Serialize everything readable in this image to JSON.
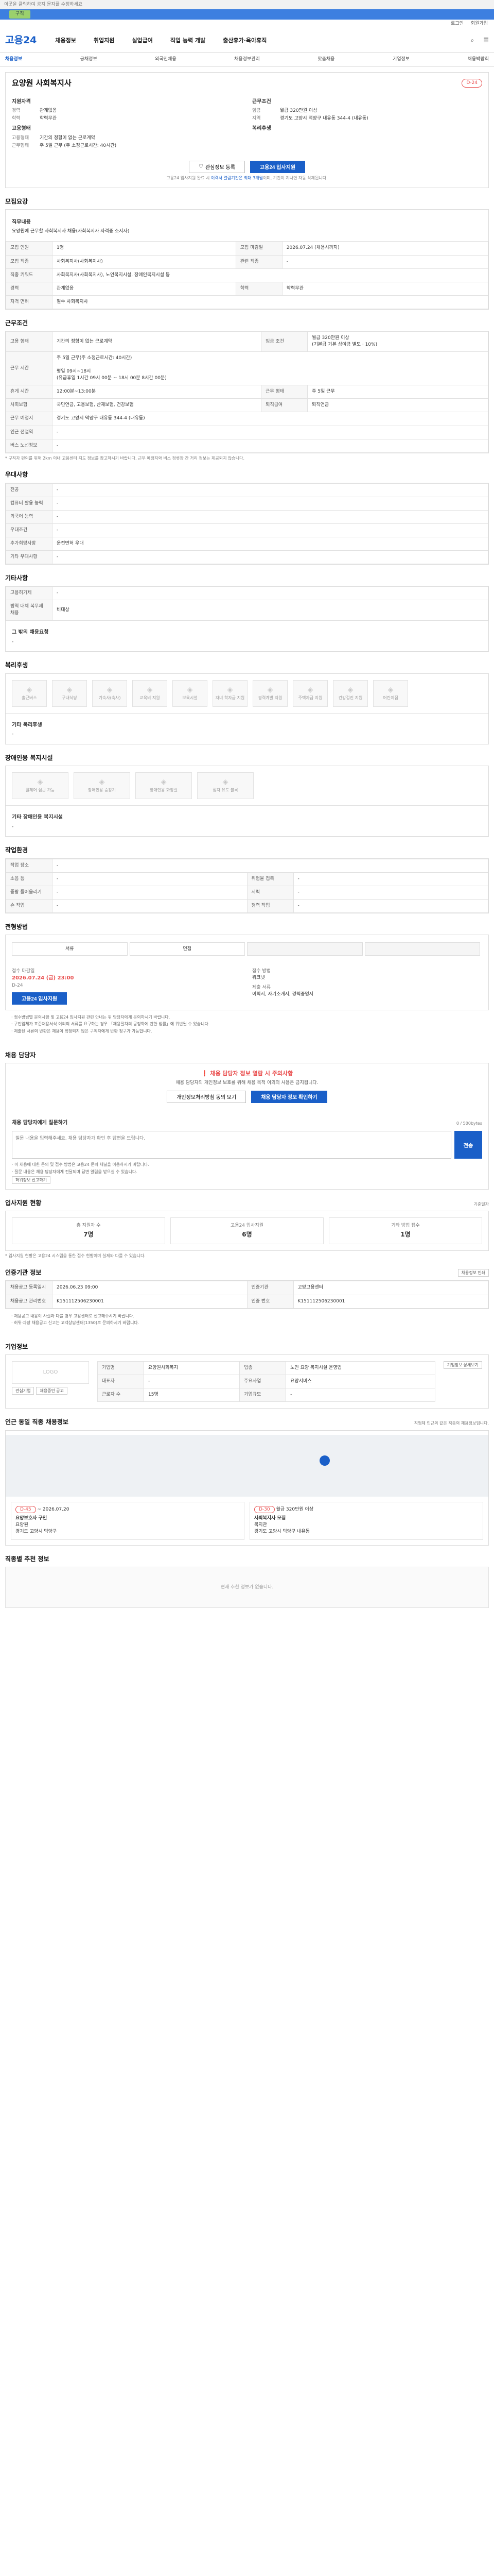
{
  "topnote": "이곳을 클릭하여 공지 문자를 수정하세요",
  "topbar_pill": "구직",
  "util": [
    "로그인",
    "회원가입"
  ],
  "logo": "고용24",
  "gnb": [
    "채용정보",
    "취업지원",
    "실업급여",
    "직업 능력 개발",
    "출산휴가·육아휴직"
  ],
  "subnav": [
    "채용정보",
    "공채정보",
    "외국인채용",
    "채용정보관리",
    "맞춤채용",
    "기업정보",
    "채용박람회"
  ],
  "job": {
    "company": "",
    "title": "요양원 사회복지사",
    "dday": "D-24",
    "qual_head": "지원자격",
    "cond_head": "근무조건",
    "qual": [
      {
        "k": "경력",
        "v": "관계없음"
      },
      {
        "k": "학력",
        "v": "학력무관"
      }
    ],
    "cond": [
      {
        "k": "임금",
        "v": "월급 320만원 이상"
      },
      {
        "k": "지역",
        "v": "경기도 고양시 덕양구 내유동 344-4 (내유동)"
      }
    ],
    "emp_head": "고용형태",
    "emp": [
      {
        "k": "고용형태",
        "v": "기간의 정함이 없는 근로계약"
      },
      {
        "k": "근무형태",
        "v": "주 5일 근무 (주 소정근로시간: 40시간)"
      }
    ],
    "welfare_head": "복리후생",
    "btn_scrap": "관심정보 등록",
    "btn_apply": "고용24 입사지원",
    "notice_pre": "고용24 입사지원 완료 시 ",
    "notice_hl": "이력서 열람기간은 최대 3개월",
    "notice_post": "이며, 기간이 지나면 자동 삭제됩니다."
  },
  "recruit": {
    "title": "모집요강",
    "duty_head": "직무내용",
    "duty_text": "요양원에 근무할 사회복지사 채용(사회복지사 자격증 소지자)",
    "rows": [
      {
        "k": "모집 인원",
        "v": "1명",
        "k2": "모집 마감일",
        "v2": "2026.07.24 (채용시까지)"
      },
      {
        "k": "모집 직종",
        "v": "사회복지사(사회복지사)",
        "k2": "관련 직종",
        "v2": "-"
      },
      {
        "k": "직종 키워드",
        "v": "사회복지사(사회복지사), 노인복지시설, 장애인복지시설 등",
        "k2": "",
        "v2": ""
      },
      {
        "k": "경력",
        "v": "관계없음",
        "k2": "학력",
        "v2": "학력무관"
      },
      {
        "k": "자격 면허",
        "v": "필수 사회복지사",
        "k2": "",
        "v2": ""
      }
    ]
  },
  "workcond": {
    "title": "근무조건",
    "rows": [
      {
        "k": "고용 형태",
        "v": "기간의 정함이 없는 근로계약",
        "k2": "임금 조건",
        "v2": "월급 320만원 이상\n(기본급 기본 상여금 별도 · 10%)"
      },
      {
        "k": "근무 시간",
        "v": "주 5일 근무(주 소정근로시간: 40시간)\n\n평일 09시~18시\n(유급휴일 1시간 09시 00분 ~ 18시 00분 8시간 00분)",
        "k2": "",
        "v2": ""
      },
      {
        "k": "휴게 시간",
        "v": "12:00분~13:00분",
        "k2": "근무 형태",
        "v2": "주 5일 근무"
      },
      {
        "k": "사회보험",
        "v": "국민연금, 고용보험, 산재보험, 건강보험",
        "k2": "퇴직급여",
        "v2": "퇴직연금"
      },
      {
        "k": "근무 예정지",
        "v": "경기도 고양시 덕양구 내유동 344-4 (내유동)",
        "k2": "",
        "v2": ""
      },
      {
        "k": "인근 전철역",
        "v": "-",
        "k2": "",
        "v2": ""
      },
      {
        "k": "버스 노선정보",
        "v": "-",
        "k2": "",
        "v2": ""
      }
    ],
    "note": "* 구직자 편의를 위해 2km 이내 고용센터 지도 정보를 참고하시기 바랍니다. 근무 예정지와 버스 정류장 간 거리 정보는 제공되지 않습니다."
  },
  "prefer": {
    "title": "우대사항",
    "rows": [
      {
        "k": "전공",
        "v": "-"
      },
      {
        "k": "컴퓨터 활용 능력",
        "v": "-"
      },
      {
        "k": "외국어 능력",
        "v": "-"
      },
      {
        "k": "우대조건",
        "v": "-"
      },
      {
        "k": "추가희망사항",
        "v": "운전면허 우대"
      },
      {
        "k": "기타 우대사항",
        "v": "-"
      }
    ]
  },
  "etc": {
    "title": "기타사항",
    "rows": [
      {
        "k": "고용허가제",
        "v": "-"
      },
      {
        "k": "병역 대체 복무제 채용",
        "v": "비대상"
      }
    ],
    "extra_head": "그 밖의 채용요청",
    "extra_val": "-"
  },
  "welfare": {
    "title": "복리후생",
    "items": [
      "출근버스",
      "구내식당",
      "기숙사(숙사)",
      "교육비 지원",
      "보육시설",
      "자녀 학자금 지원",
      "경력계발 지원",
      "주택자금 지원",
      "건강검진 지원",
      "어린이집"
    ],
    "other_head": "기타 복리후생",
    "other_val": "-"
  },
  "disabled": {
    "title": "장애인용 복지시설",
    "items": [
      "휠체어 접근 가능",
      "장애인용 승강기",
      "장애인용 화장실",
      "점자 유도 블록"
    ],
    "other_head": "기타 장애인용 복지시설",
    "other_val": "-"
  },
  "env": {
    "title": "작업환경",
    "rows": [
      {
        "k": "작업 장소",
        "v": "-",
        "k2": "",
        "v2": ""
      },
      {
        "k": "소음 등",
        "v": "-",
        "k2": "위험물 접촉",
        "v2": "-"
      },
      {
        "k": "중량 들어올리기",
        "v": "-",
        "k2": "시력",
        "v2": "-"
      },
      {
        "k": "손 작업",
        "v": "-",
        "k2": "청력 작업",
        "v2": "-"
      }
    ]
  },
  "process": {
    "title": "전형방법",
    "steps": [
      "서류",
      "면접",
      "",
      ""
    ],
    "apply_lbl": "접수 마감일",
    "apply_date": "2026.07.24 (금) 23:00",
    "apply_note": "D-24",
    "apply_btn": "고용24 입사지원",
    "method_lbl": "접수 방법",
    "method_val": "워크넷",
    "doc_lbl": "제출 서류",
    "doc_val": "이력서, 자기소개서, 경력증명서",
    "bullets": [
      "· 접수방법별 문의사항 및 고용24 입사지원 관련 안내는 위 담당자에게 문의하시기 바랍니다.",
      "· 구인업체가 표준채용서식 이외의 서류를 요구하는 경우 「채용절차의 공정화에 관한 법률」에 위반될 수 있습니다.",
      "· 제출된 서류의 반환은 채용이 확정되지 않은 구직자에게 반환 청구가 가능합니다."
    ]
  },
  "contact": {
    "title": "채용 담당자",
    "alert_head": "채용 담당자 정보 열람 시 주의사항",
    "alert_body": "채용 담당자의 개인정보 보호를 위해 채용 목적 이외의 사용은 금지됩니다.",
    "btn_view": "채용 담당자 정보 확인하기",
    "btn_privacy": "개인정보처리방침 동의 보기",
    "qna_head": "채용 담당자에게 질문하기",
    "qna_placeholder": "질문 내용을 입력해주세요. 채용 담당자가 확인 후 답변을 드립니다.",
    "qna_send": "전송",
    "qna_count": "0 / 500bytes",
    "tips": [
      "· 이 채용에 대한 문의 및 접수 방법은 고용24 문의 채널을 이용하시기 바랍니다.",
      "· 질문 내용은 채용 담당자에게 전달되며 답변 알림을 받으실 수 있습니다."
    ],
    "report_btn": "허위정보 신고하기"
  },
  "status": {
    "title": "입사지원 현황",
    "unit": "기준일자",
    "items": [
      {
        "label": "총 지원자 수",
        "value": "7명"
      },
      {
        "label": "고용24 입사지원",
        "value": "6명"
      },
      {
        "label": "기타 방법 접수",
        "value": "1명"
      }
    ],
    "note": "* 입사지원 현황은 고용24 시스템을 통한 접수 현황이며 실제와 다를 수 있습니다."
  },
  "meta": {
    "title": "인증기관 정보",
    "print_btn": "채용정보 인쇄",
    "rows": [
      {
        "k": "채용공고 등록일시",
        "v": "2026.06.23 09:00",
        "k2": "인증기관",
        "v2": "고양고용센터"
      },
      {
        "k": "채용공고 관리번호",
        "v": "K151112506230001",
        "k2": "인증 번호",
        "v2": "K151112506230001"
      }
    ],
    "bullets": [
      "· 채용공고 내용이 사실과 다를 경우 고용센터로 신고해주시기 바랍니다.",
      "· 허위·과장 채용공고 신고는 고객상담센터(1350)로 문의하시기 바랍니다."
    ]
  },
  "company": {
    "title": "기업정보",
    "logo_text": "LOGO",
    "btn_detail": "기업정보 상세보기",
    "btn_scrap": "관심기업",
    "btn_other": "채용중인 공고",
    "rows": [
      {
        "k": "기업명",
        "v": "요양원사회복지",
        "k2": "업종",
        "v2": "노인 요양 복지시설 운영업"
      },
      {
        "k": "대표자",
        "v": "-",
        "k2": "주요사업",
        "v2": "요양서비스"
      },
      {
        "k": "근로자 수",
        "v": "15명",
        "k2": "기업규모",
        "v2": "-"
      }
    ]
  },
  "nearby": {
    "title": "인근 동일 직종 채용정보",
    "note": "직업체 인근의 같은 직종의 채용정보입니다.",
    "items": [
      {
        "dday": "D-45",
        "date": "~ 2026.07.20",
        "name": "요양보호사 구인",
        "company": "요양원",
        "addr": "경기도 고양시 덕양구"
      },
      {
        "dday": "D-30",
        "date": "월급 320만원 이상",
        "name": "사회복지사 모집",
        "company": "복지관",
        "addr": "경기도 고양시 덕양구 내유동"
      }
    ]
  },
  "recommend": {
    "title": "직종별 추천 정보",
    "empty": "현재 추천 정보가 없습니다."
  },
  "colors": {
    "primary": "#1a5fc8",
    "danger": "#e94d4d",
    "topbar": "#3d7fe0"
  }
}
